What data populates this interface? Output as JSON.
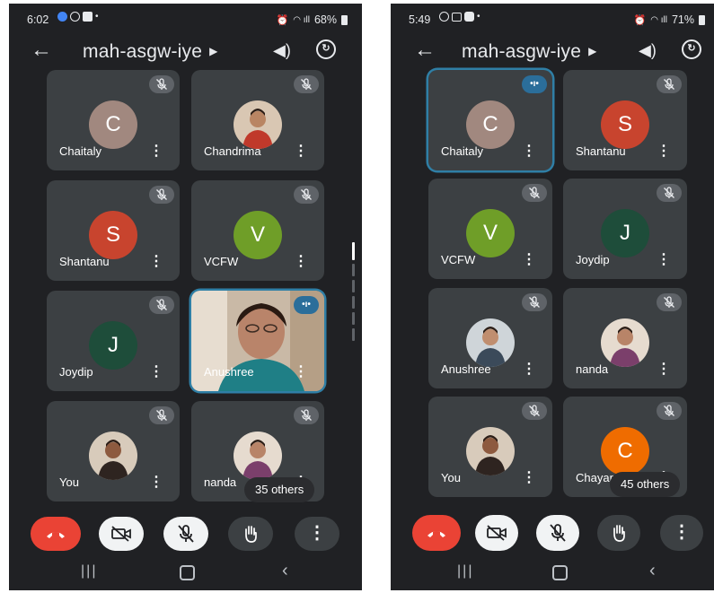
{
  "left": {
    "status": {
      "time": "6:02",
      "battery": "68%"
    },
    "meeting_title": "mah-asgw-iye",
    "tiles": [
      {
        "name": "Chaitaly",
        "avatar_letter": "C",
        "avatar_color": "#a1887f",
        "type": "letter",
        "mic": "muted"
      },
      {
        "name": "Chandrima",
        "type": "photo",
        "mic": "muted"
      },
      {
        "name": "Shantanu",
        "avatar_letter": "S",
        "avatar_color": "#c8442e",
        "type": "letter",
        "mic": "muted"
      },
      {
        "name": "VCFW",
        "avatar_letter": "V",
        "avatar_color": "#6f9e28",
        "type": "letter",
        "mic": "muted"
      },
      {
        "name": "Joydip",
        "avatar_letter": "J",
        "avatar_color": "#1e4d3a",
        "type": "letter",
        "mic": "muted"
      },
      {
        "name": "Anushree",
        "type": "video",
        "mic": "speaking"
      },
      {
        "name": "You",
        "type": "photo",
        "mic": "muted"
      },
      {
        "name": "nanda",
        "type": "photo",
        "mic": "muted"
      }
    ],
    "others_label": "35 others"
  },
  "right": {
    "status": {
      "time": "5:49",
      "battery": "71%"
    },
    "meeting_title": "mah-asgw-iye",
    "tiles": [
      {
        "name": "Chaitaly",
        "avatar_letter": "C",
        "avatar_color": "#a1887f",
        "type": "letter",
        "mic": "speaking"
      },
      {
        "name": "Shantanu",
        "avatar_letter": "S",
        "avatar_color": "#c8442e",
        "type": "letter",
        "mic": "muted"
      },
      {
        "name": "VCFW",
        "avatar_letter": "V",
        "avatar_color": "#6f9e28",
        "type": "letter",
        "mic": "muted"
      },
      {
        "name": "Joydip",
        "avatar_letter": "J",
        "avatar_color": "#1e4d3a",
        "type": "letter",
        "mic": "muted"
      },
      {
        "name": "Anushree",
        "type": "photo",
        "mic": "muted"
      },
      {
        "name": "nanda",
        "type": "photo",
        "mic": "muted"
      },
      {
        "name": "You",
        "type": "photo",
        "mic": "muted"
      },
      {
        "name": "Chayan",
        "avatar_letter": "C",
        "avatar_color": "#ef6c00",
        "type": "letter",
        "mic": "muted"
      }
    ],
    "others_label": "45 others"
  },
  "colors": {
    "background": "#202124",
    "tile": "#3c4043",
    "end_call": "#ea4335",
    "speaking_border": "#2f7fa6"
  },
  "icons": [
    "back-arrow-icon",
    "caret-right-icon",
    "speaker-icon",
    "switch-camera-icon",
    "mic-off-icon",
    "speaking-indicator-icon",
    "more-vert-icon",
    "end-call-icon",
    "video-off-icon",
    "raise-hand-icon"
  ]
}
